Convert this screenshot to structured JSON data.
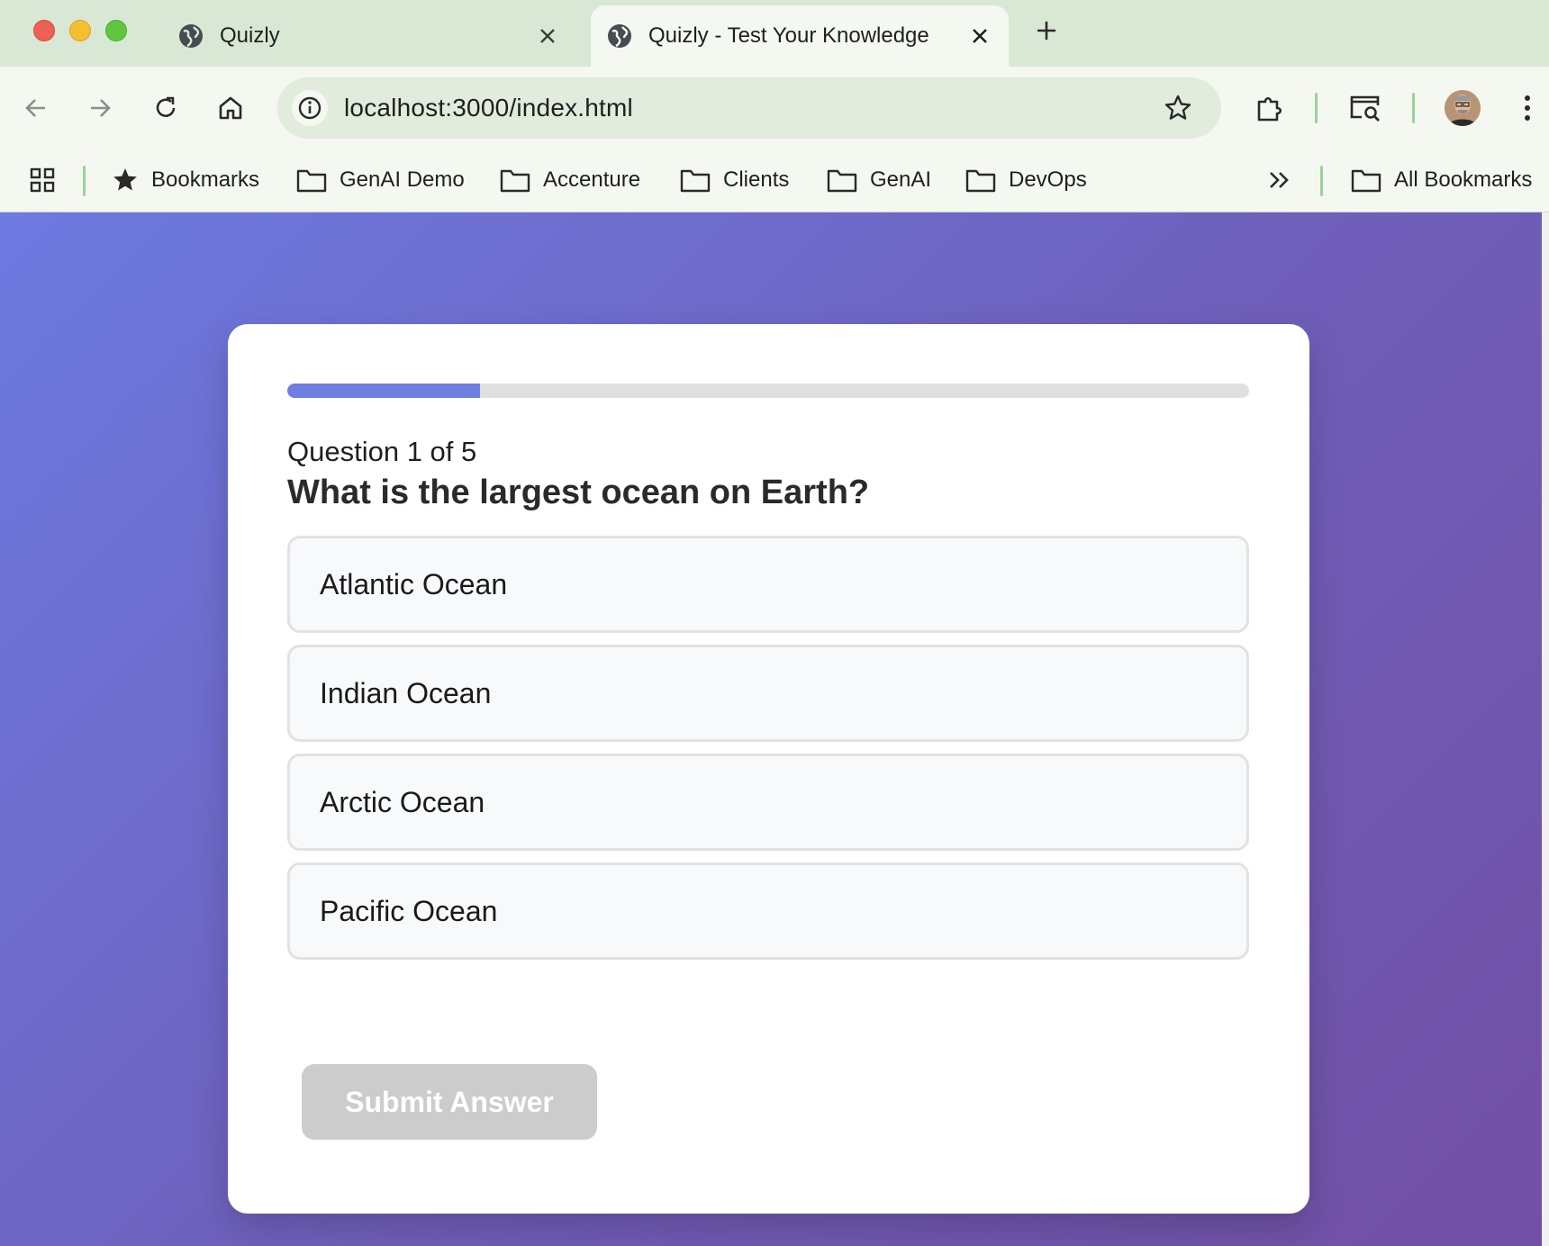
{
  "browser": {
    "tabs": [
      {
        "title": "Quizly",
        "active": false
      },
      {
        "title": "Quizly - Test Your Knowledge",
        "active": true
      }
    ],
    "url": "localhost:3000/index.html",
    "bookmarks": [
      "Bookmarks",
      "GenAI Demo",
      "Accenture",
      "Clients",
      "GenAI",
      "DevOps"
    ],
    "all_bookmarks_label": "All Bookmarks",
    "accent_color": "#9cd19a"
  },
  "quiz": {
    "question_counter": "Question 1 of 5",
    "question": "What is the largest ocean on Earth?",
    "progress_fraction": 0.2,
    "options": [
      "Atlantic Ocean",
      "Indian Ocean",
      "Arctic Ocean",
      "Pacific Ocean"
    ],
    "submit_label": "Submit Answer",
    "submit_enabled": false,
    "colors": {
      "progress_fill": "#6e7fe2",
      "background_gradient_start": "#6d7ae0",
      "background_gradient_end": "#714fa4",
      "submit_disabled": "#cccccc"
    }
  }
}
